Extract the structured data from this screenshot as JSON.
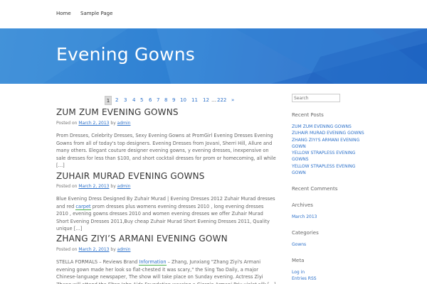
{
  "nav": {
    "home": "Home",
    "sample": "Sample Page"
  },
  "banner": {
    "title": "Evening Gowns"
  },
  "pagination": {
    "current": "1",
    "links": [
      "2",
      "3",
      "4",
      "5",
      "6",
      "7",
      "8",
      "9",
      "10",
      "11",
      "12"
    ],
    "ellipsis": "…",
    "last": "222",
    "next": "»"
  },
  "posts": [
    {
      "title": "ZUM ZUM EVENING GOWNS",
      "meta_prefix": "Posted on",
      "date": "March 2, 2013",
      "by": "by",
      "author": "admin",
      "excerpt": "Prom Dresses, Celebrity Dresses, Sexy Evening Gowns at PromGirl Evening Dresses Evening Gowns from all of today's top designers. Evening Dresses from Jovani, Sherri Hill, Allure and many others. Elegant couture designer evening gowns, y evening dresses, inexpensive on sale dresses for less than $100, and short cocktail dresses for prom or homecoming, all while […]"
    },
    {
      "title": "ZUHAIR MURAD EVENING GOWNS",
      "meta_prefix": "Posted on",
      "date": "March 2, 2013",
      "by": "by",
      "author": "admin",
      "excerpt_a": "Blue Evening Dress Designed By Zuhair Murad | Evening Dresses 2012 Zuhair Murad dresses and red",
      "excerpt_link": "carpet",
      "excerpt_b": " prom dresses plus womens evening dresses 2010 , long evening dresses 2010 , evening gowns dresses 2010 and women evening dresses we offer Zuhair Murad Short Evening Dresses 2011,Buy cheap Zuhair Murad Short Evening Dresses 2011, Quality unique […]"
    },
    {
      "title": "ZHANG ZIYI’S ARMANI EVENING GOWN",
      "meta_prefix": "Posted on",
      "date": "March 2, 2013",
      "by": "by",
      "author": "admin",
      "excerpt_a": "STELLA FORMALS – Reviews Brand ",
      "excerpt_link": "Information",
      "excerpt_b": " – Zhang, Junxiang \"Zhang Ziyi's Armani evening gown made her look so flat-chested it was scary,\" the Sing Tao Daily, a major Chinese-language newspaper, The show will take place on Sunday evening. Actress Ziyi Zhang will attend the Elton John Aids Foundation wearing a Giorgio Armani Priv violet silk […]"
    }
  ],
  "sidebar": {
    "search_placeholder": "Search",
    "recent_posts_title": "Recent Posts",
    "recent_posts": [
      "ZUM ZUM EVENING GOWNS",
      "ZUHAIR MURAD EVENING GOWNS",
      "ZHANG ZIYI'S ARMANI EVENING GOWN",
      "YELLOW STRAPLESS EVENING GOWNS",
      "YELLOW STRAPLESS EVENING GOWN"
    ],
    "recent_comments_title": "Recent Comments",
    "archives_title": "Archives",
    "archives": [
      "March 2013"
    ],
    "categories_title": "Categories",
    "categories": [
      "Gowns"
    ],
    "meta_title": "Meta",
    "meta": [
      "Log in",
      "Entries RSS"
    ]
  }
}
